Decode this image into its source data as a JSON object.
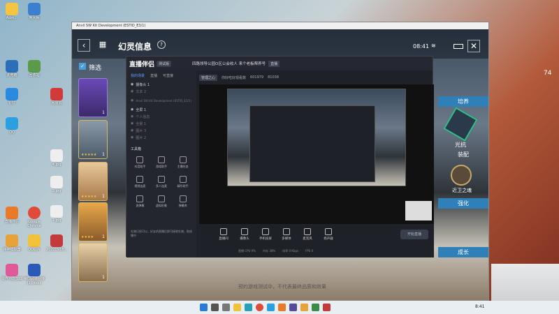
{
  "desktop": {
    "icons": [
      {
        "label": "Adm..."
      },
      {
        "label": "此电脑"
      },
      {
        "label": "鲁大师"
      },
      {
        "label": "回收站"
      },
      {
        "label": "钉钉"
      },
      {
        "label": "网易云"
      },
      {
        "label": "QQ"
      },
      {
        "label": "Google Chrome"
      },
      {
        "label": "4.jpg"
      },
      {
        "label": "2.jpg"
      },
      {
        "label": "1.jpg"
      },
      {
        "label": "直播伴侣"
      },
      {
        "label": "QQ图片"
      },
      {
        "label": "20220918..."
      },
      {
        "label": "夜神模拟器"
      },
      {
        "label": "零界功能加载"
      },
      {
        "label": "帝国武装对接(1).docx"
      }
    ]
  },
  "game": {
    "window_title": "Anvil SW Kit Development (ESTID_E3/1)",
    "page_title": "幻灵信息",
    "time": "08:41",
    "filter_label": "筛选",
    "cards": [
      {
        "level": "1"
      },
      {
        "level": "1"
      },
      {
        "level": "1"
      },
      {
        "level": "1"
      },
      {
        "level": "1"
      }
    ],
    "right_buttons": {
      "train": "培养",
      "equip": "装配",
      "upgrade": "强化",
      "growth": "成长"
    },
    "skills": [
      {
        "label": "光抗"
      },
      {
        "label": "近卫之魂"
      }
    ],
    "right_counter": "74",
    "footer_text": "预约游戏测试中，不代表最终品质和效果"
  },
  "stream_app": {
    "logo": "直播伴侣",
    "beta": "测试版",
    "tabs": [
      "我的场景",
      "直播",
      "可直接"
    ],
    "sources": [
      {
        "label": "摄像头 1",
        "dim": false
      },
      {
        "label": "文本 2",
        "dim": true
      },
      {
        "label": "Anvil SW Kit Development (ESTID_E3/1)",
        "dim": true
      },
      {
        "label": "全屏 1",
        "dim": false
      },
      {
        "label": "个人信息",
        "dim": true
      },
      {
        "label": "全景 1",
        "dim": true
      },
      {
        "label": "图片 3",
        "dim": true
      },
      {
        "label": "图片 2",
        "dim": true
      }
    ],
    "toolbox_title": "工具箱",
    "tools": [
      "抖音助手",
      "游戏助手",
      "主播任务",
      "视频连麦",
      "多人连麦",
      "精华助手",
      "说弹幕",
      "虚拟形象",
      "弹幕库",
      "直播间",
      "",
      "礼物"
    ],
    "notice": "礼物已经可以，好友的直播后即可接收礼物，取成播中",
    "channel_name": "四路领导公园O区公会收人 来个老板帮养号",
    "channel_tag": "直播",
    "room_label": "管理之心",
    "fan_label": "你好吃好观看数",
    "fan_count": "601979",
    "heat": "81038",
    "bottom_buttons": [
      "直播间",
      "摄像头",
      "手机投屏",
      "多媒体",
      "麦克风",
      "扬声器"
    ],
    "start_label": "开始直播",
    "status_items": [
      "直播 CPU 9%",
      "内存 38%",
      "码率 0 Kbps",
      "FPS 0"
    ]
  },
  "taskbar": {
    "time": "8:41"
  }
}
